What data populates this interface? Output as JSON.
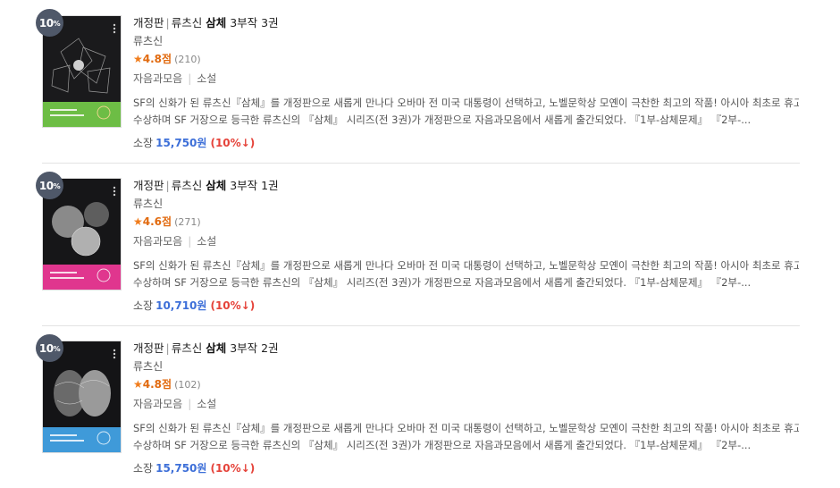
{
  "books": [
    {
      "badge": "10",
      "badge_pct": "%",
      "edition": "개정판",
      "author_prefix": "류츠신",
      "series_bold": "삼체",
      "series_rest": "3부작 3권",
      "author": "류츠신",
      "rating": "4.8점",
      "review_count": "(210)",
      "publisher": "자음과모음",
      "category": "소설",
      "desc_line1": "SF의 신화가 된 류츠신『삼체』를 개정판으로 새롭게 만나다 오바마 전 미국 대통령이 선택하고, 노벨문학상 모옌이 극찬한 최고의 작품! 아시아 최초로 휴고상을",
      "desc_line2": "수상하며 SF 거장으로 등극한 류츠신의 『삼체』 시리즈(전 3권)가 개정판으로 자음과모음에서 새롭게 출간되었다. 『1부-삼체문제』 『2부-...",
      "price_label": "소장",
      "price": "15,750원",
      "discount": "(10%↓)",
      "cover_color": "#6dbd45"
    },
    {
      "badge": "10",
      "badge_pct": "%",
      "edition": "개정판",
      "author_prefix": "류츠신",
      "series_bold": "삼체",
      "series_rest": "3부작 1권",
      "author": "류츠신",
      "rating": "4.6점",
      "review_count": "(271)",
      "publisher": "자음과모음",
      "category": "소설",
      "desc_line1": "SF의 신화가 된 류츠신『삼체』를 개정판으로 새롭게 만나다 오바마 전 미국 대통령이 선택하고, 노벨문학상 모옌이 극찬한 최고의 작품! 아시아 최초로 휴고상을",
      "desc_line2": "수상하며 SF 거장으로 등극한 류츠신의 『삼체』 시리즈(전 3권)가 개정판으로 자음과모음에서 새롭게 출간되었다. 『1부-삼체문제』 『2부-...",
      "price_label": "소장",
      "price": "10,710원",
      "discount": "(10%↓)",
      "cover_color": "#e0368e"
    },
    {
      "badge": "10",
      "badge_pct": "%",
      "edition": "개정판",
      "author_prefix": "류츠신",
      "series_bold": "삼체",
      "series_rest": "3부작 2권",
      "author": "류츠신",
      "rating": "4.8점",
      "review_count": "(102)",
      "publisher": "자음과모음",
      "category": "소설",
      "desc_line1": "SF의 신화가 된 류츠신『삼체』를 개정판으로 새롭게 만나다 오바마 전 미국 대통령이 선택하고, 노벨문학상 모옌이 극찬한 최고의 작품! 아시아 최초로 휴고상을",
      "desc_line2": "수상하며 SF 거장으로 등극한 류츠신의 『삼체』 시리즈(전 3권)가 개정판으로 자음과모음에서 새롭게 출간되었다. 『1부-삼체문제』 『2부-...",
      "price_label": "소장",
      "price": "15,750원",
      "discount": "(10%↓)",
      "cover_color": "#3f9ad9"
    }
  ],
  "icons": {
    "star": "star-icon",
    "discount_arrow": "down-arrow"
  }
}
